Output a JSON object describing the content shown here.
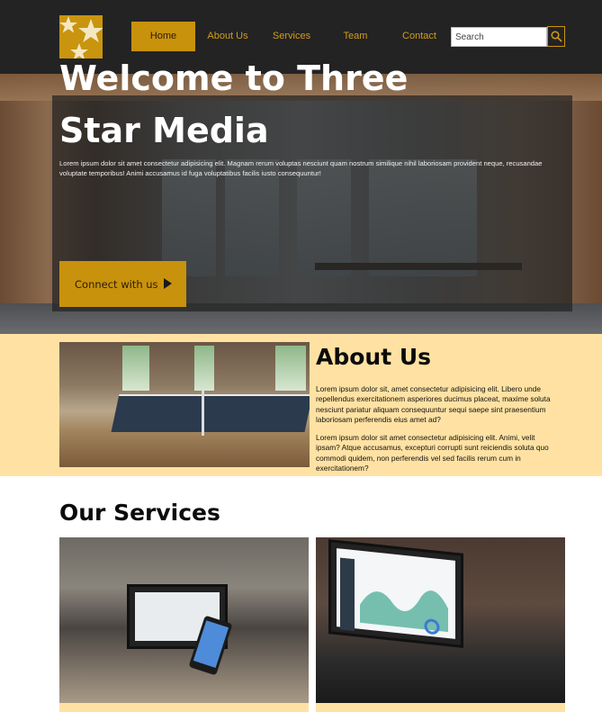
{
  "nav": {
    "items": [
      {
        "label": "Home",
        "active": true
      },
      {
        "label": "About Us",
        "active": false
      },
      {
        "label": "Services",
        "active": false
      },
      {
        "label": "Team",
        "active": false
      },
      {
        "label": "Contact",
        "active": false
      }
    ],
    "search_placeholder": "Search",
    "logo_icon": "three-stars-logo",
    "search_icon": "search-icon"
  },
  "hero": {
    "title": "Welcome to Three Star Media",
    "text": "Lorem ipsum dolor sit amet consectetur adipisicing elit. Magnam rerum voluptas nesciunt quam nostrum similique nihil laboriosam provident neque, recusandae voluptate temporibus! Animi accusamus id fuga voluptatibus facilis iusto consequuntur!",
    "cta_label": "Connect with us",
    "cta_icon": "play-triangle-icon"
  },
  "about": {
    "title": "About Us",
    "paragraphs": [
      "Lorem ipsum dolor sit, amet consectetur adipisicing elit. Libero unde repellendus exercitationem asperiores ducimus placeat, maxime soluta nesciunt pariatur aliquam consequuntur sequi saepe sint praesentium laboriosam perferendis eius amet ad?",
      "Lorem ipsum dolor sit amet consectetur adipisicing elit. Animi, velit ipsam? Atque accusamus, excepturi corrupti sunt reiciendis soluta quo commodi quidem, non perferendis vel sed facilis rerum cum in exercitationem?"
    ]
  },
  "services": {
    "title": "Our Services"
  },
  "colors": {
    "nav_bg": "#232323",
    "accent": "#c9920c",
    "nav_text": "#d39c1a",
    "about_bg": "#ffe2a3"
  }
}
